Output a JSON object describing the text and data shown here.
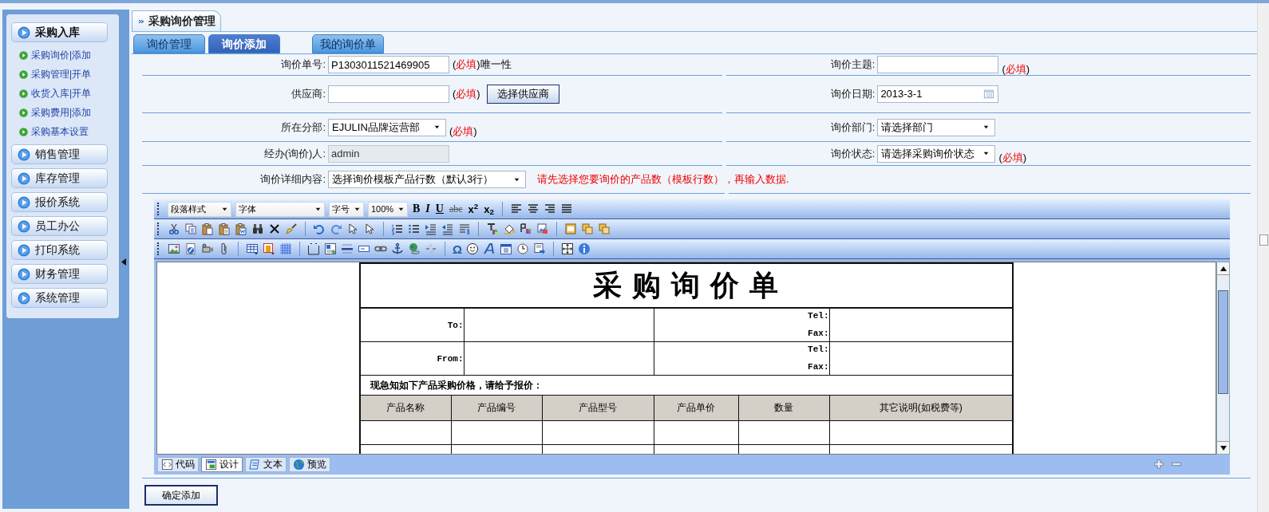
{
  "sidebar": {
    "groups": [
      {
        "label": "采购入库",
        "expanded": true,
        "items": [
          "采购询价|添加",
          "采购管理|开单",
          "收货入库|开单",
          "采购费用|添加",
          "采购基本设置"
        ]
      },
      {
        "label": "销售管理",
        "expanded": false
      },
      {
        "label": "库存管理",
        "expanded": false
      },
      {
        "label": "报价系统",
        "expanded": false
      },
      {
        "label": "员工办公",
        "expanded": false
      },
      {
        "label": "打印系统",
        "expanded": false
      },
      {
        "label": "财务管理",
        "expanded": false
      },
      {
        "label": "系统管理",
        "expanded": false
      }
    ]
  },
  "page_title": "采购询价管理",
  "tabs": [
    {
      "label": "询价管理",
      "selected": false
    },
    {
      "label": "询价添加",
      "selected": true
    },
    {
      "label": "我的询价单",
      "selected": false
    }
  ],
  "form": {
    "rows": [
      {
        "left": {
          "label": "询价单号:",
          "kind": "text",
          "value": "P1303011521469905",
          "note": [
            "(",
            "必填",
            ")唯一性"
          ]
        },
        "right": {
          "label": "询价主题:",
          "kind": "text",
          "note": [
            "(",
            "必填",
            ")"
          ]
        }
      },
      {
        "left": {
          "label": "供应商:",
          "kind": "text",
          "note": [
            "(",
            "必填",
            ")"
          ],
          "button": "选择供应商"
        },
        "right": {
          "label": "询价日期:",
          "kind": "date",
          "value": "2013-3-1"
        }
      },
      {
        "left": {
          "label": "所在分部:",
          "kind": "select",
          "value": "EJULIN品牌运营部",
          "note": [
            "(",
            "必填",
            ")"
          ]
        },
        "right": {
          "label": "询价部门:",
          "kind": "select",
          "value": "请选择部门"
        }
      },
      {
        "left": {
          "label": "经办(询价)人:",
          "kind": "readonly",
          "value": "admin"
        },
        "right": {
          "label": "询价状态:",
          "kind": "select",
          "value": "请选择采购询价状态",
          "note": [
            "(",
            "必填",
            ")"
          ]
        }
      },
      {
        "left": {
          "label": "询价详细内容:",
          "kind": "select",
          "value": "选择询价模板产品行数（默认3行）",
          "hint": "请先选择您要询价的产品数（模板行数），再输入数据."
        }
      }
    ]
  },
  "editor": {
    "dropdowns": [
      "段落样式",
      "字体",
      "字号",
      "100%"
    ],
    "format_buttons": [
      "B",
      "I",
      "U",
      "abc",
      "x$^{2}$",
      "x$_{2}$"
    ],
    "special_char": "Ω",
    "document": {
      "title": "采 购 询 价 单",
      "contacts": [
        {
          "label": "To:",
          "phone_label": "Tel:",
          "fax_label": "Fax:"
        },
        {
          "label": "From:",
          "phone_label": "Tel:",
          "fax_label": "Fax:"
        }
      ],
      "notice": "现急知如下产品采购价格，请给予报价：",
      "columns": [
        "产品名称",
        "产品编号",
        "产品型号",
        "产品单价",
        "数量",
        "其它说明(如税费等)"
      ]
    },
    "mode_tabs": [
      {
        "label": "代码",
        "selected": false
      },
      {
        "label": "设计",
        "selected": true
      },
      {
        "label": "文本",
        "selected": false
      },
      {
        "label": "预览",
        "selected": false
      }
    ]
  },
  "submit_button": "确定添加"
}
